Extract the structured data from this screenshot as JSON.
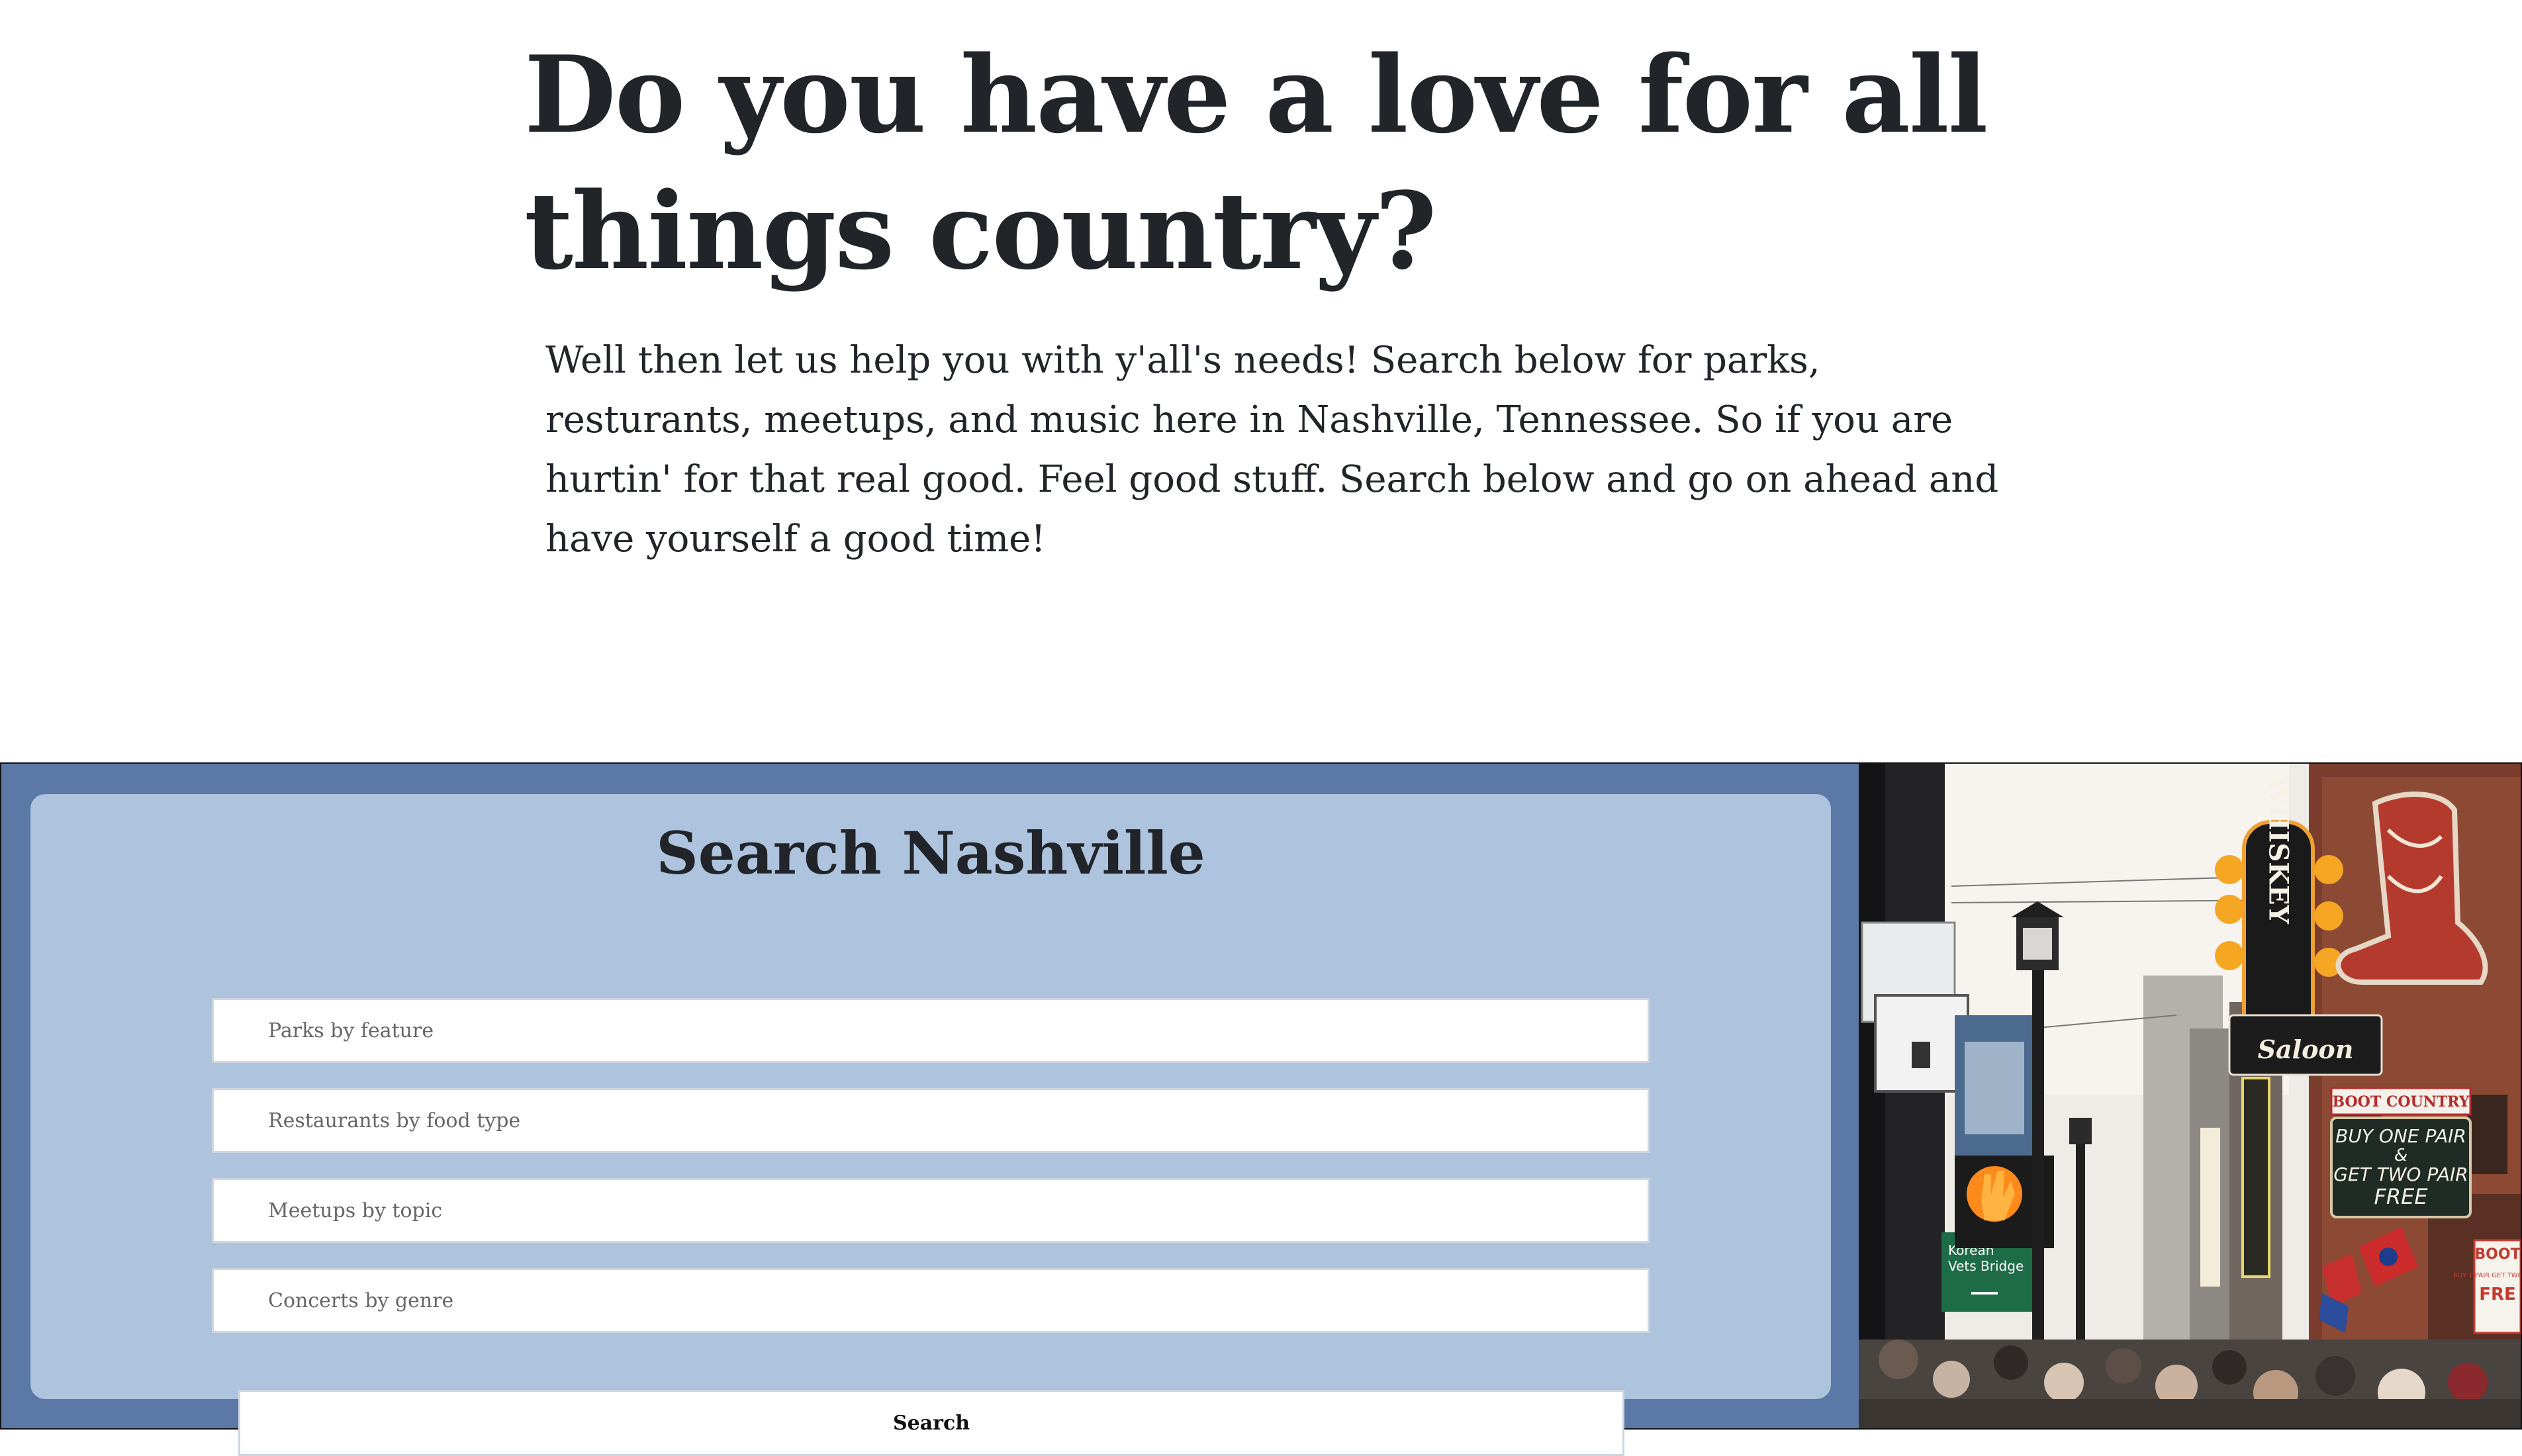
{
  "hero": {
    "title": "Do you have a love for all things country?",
    "text": "Well then let us help you with y'all's needs! Search below for parks, resturants, meetups, and music here in Nashville, Tennessee. So if you are hurtin' for that real good. Feel good stuff. Search below and go on ahead and have yourself a good time!"
  },
  "search": {
    "title": "Search Nashville",
    "fields": {
      "parks_placeholder": "Parks by feature",
      "restaurants_placeholder": "Restaurants by food type",
      "meetups_placeholder": "Meetups by topic",
      "concerts_placeholder": "Concerts by genre"
    },
    "button_label": "Search"
  },
  "photo": {
    "signs": {
      "whiskey": "WHISKEY",
      "saloon": "Saloon",
      "boot_country": "BOOT COUNTRY",
      "buy_one_pair_line1": "BUY ONE PAIR",
      "buy_one_pair_line2": "&",
      "buy_one_pair_line3": "GET TWO PAIR",
      "free": "FREE",
      "street_line1": "Korean",
      "street_line2": "Vets Bridge",
      "boot_side": "BOOT",
      "boot_side_small": "BUY 1 PAIR GET TWO FREE",
      "boot_side_free": "FRE"
    }
  },
  "colors": {
    "section_blue": "#5b78a6",
    "panel_blue": "#aec3de",
    "text_dark": "#212529"
  }
}
